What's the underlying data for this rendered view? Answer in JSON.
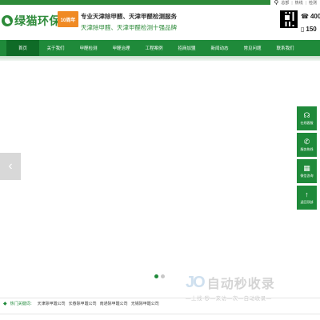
{
  "top_links": [
    "总部",
    "热线",
    "检测"
  ],
  "header": {
    "logo_text": "绿猫环保",
    "badge": "10周年",
    "slogan_line1": "专业天津除甲醛、天津甲醛检测服务",
    "slogan_line2": "天津除甲醛、天津甲醛检测十强品牌",
    "phone1": "400",
    "phone2": "150"
  },
  "nav": [
    {
      "label": "首页",
      "active": true
    },
    {
      "label": "关于我们"
    },
    {
      "label": "甲醛检测"
    },
    {
      "label": "甲醛治理"
    },
    {
      "label": "工程案例"
    },
    {
      "label": "招商加盟"
    },
    {
      "label": "新闻动态"
    },
    {
      "label": "常见问题"
    },
    {
      "label": "联系我们"
    }
  ],
  "side": [
    {
      "label": "在线客服",
      "icon": "headset-icon"
    },
    {
      "label": "服务热线",
      "icon": "phone-icon"
    },
    {
      "label": "微信咨询",
      "icon": "qrcode-icon"
    },
    {
      "label": "返回顶部",
      "icon": "arrow-up-icon"
    }
  ],
  "watermark": {
    "title": "自动秒收录",
    "sub": "—上线·秒—来访—次—自动收录—"
  },
  "footer": {
    "hot_label": "热门关键词：",
    "keywords": [
      "天津除甲醛公司",
      "长春除甲醛公司",
      "南通除甲醛公司",
      "无锡除甲醛公司"
    ]
  },
  "colors": {
    "brand_green": "#1f8a3a",
    "badge_orange": "#f08a24"
  }
}
